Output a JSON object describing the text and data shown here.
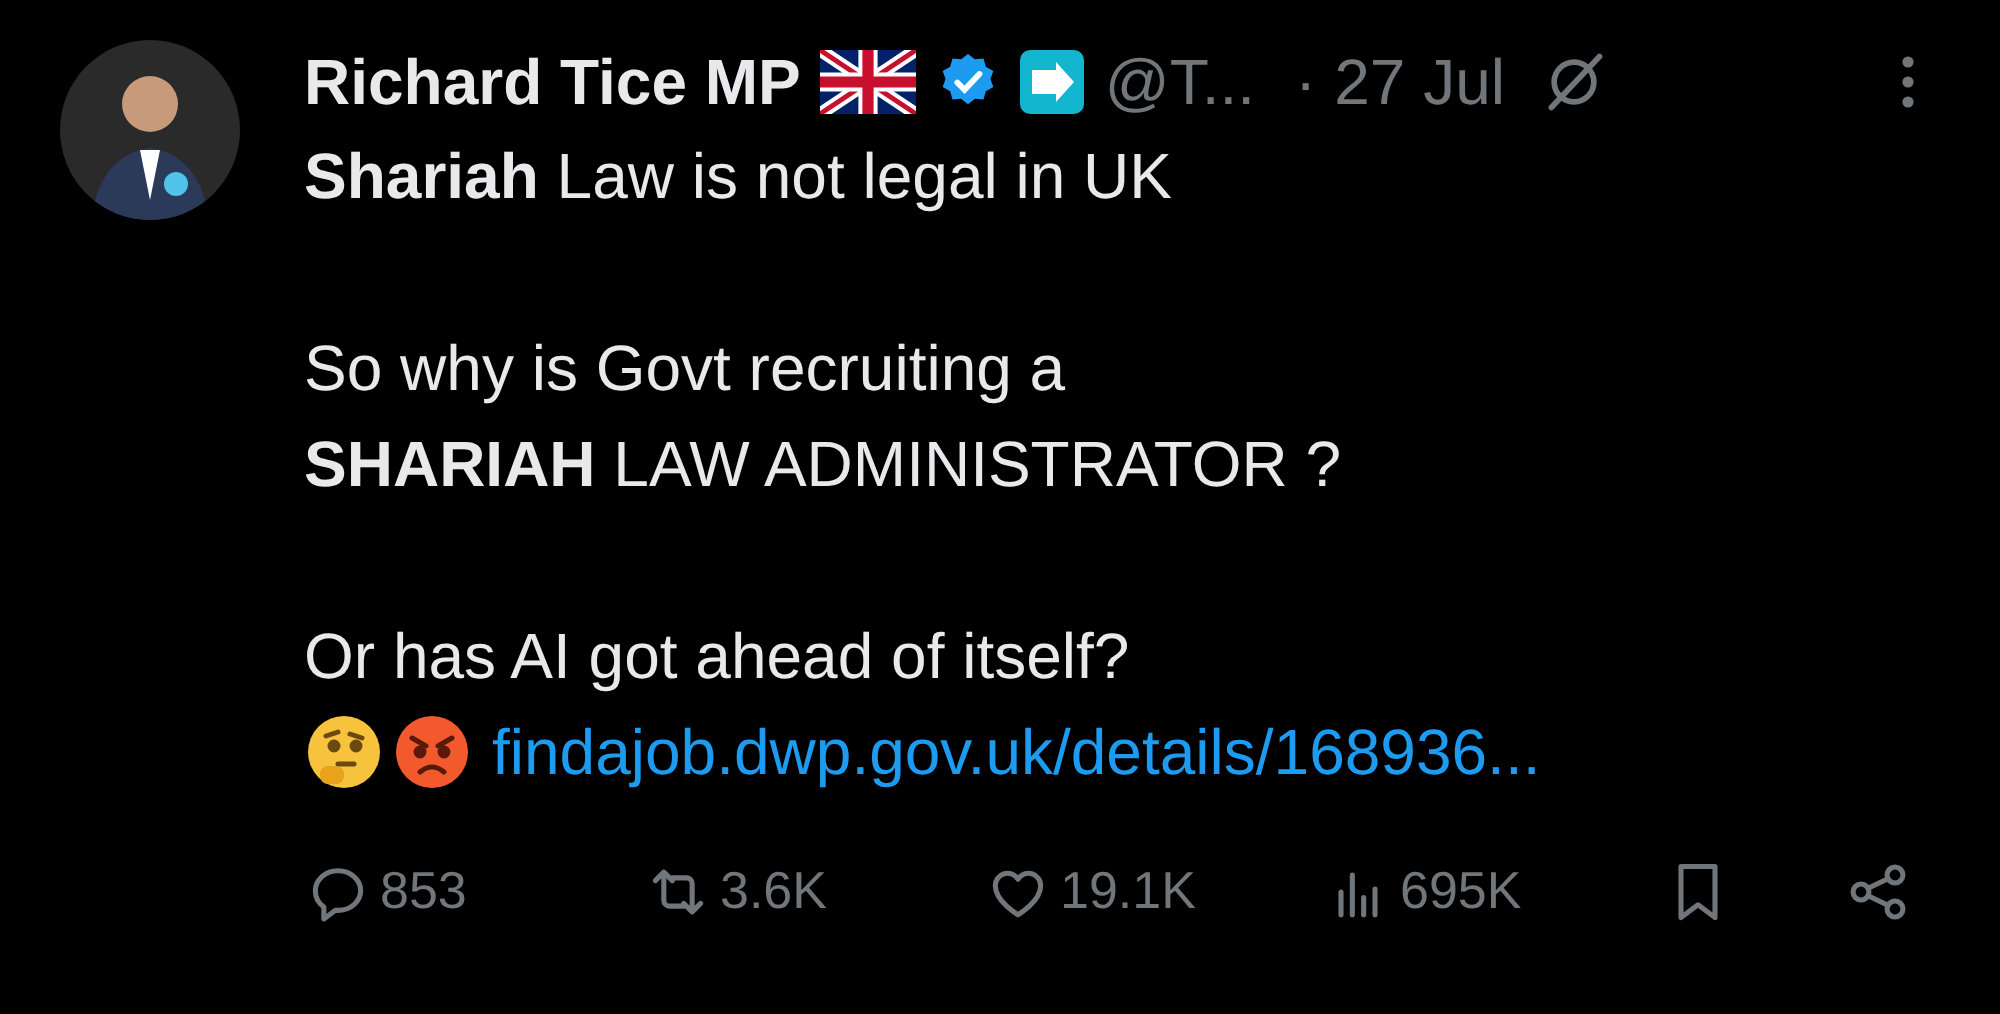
{
  "author": {
    "name": "Richard Tice MP",
    "verified": true,
    "handle": "@T...",
    "date": "· 27 Jul"
  },
  "body": [
    {
      "lines": [
        "**Shariah** Law is not legal in UK"
      ]
    },
    {
      "lines": [
        "So why is Govt recruiting a",
        "**SHARIAH** LAW ADMINISTRATOR ?"
      ]
    },
    {
      "lines": [
        "Or has AI got ahead of itself?"
      ]
    }
  ],
  "link": {
    "text": "findajob.dwp.gov.uk/details/168936..."
  },
  "actions": [
    {
      "kind": "reply",
      "count": "853"
    },
    {
      "kind": "repost",
      "count": "3.6K"
    },
    {
      "kind": "like",
      "count": "19.1K"
    },
    {
      "kind": "views",
      "count": "695K"
    },
    {
      "kind": "bookmark"
    },
    {
      "kind": "share"
    }
  ]
}
